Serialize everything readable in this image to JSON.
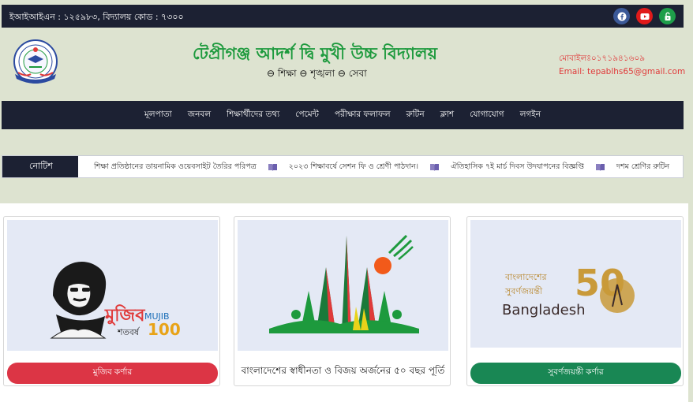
{
  "topbar": {
    "info": "ইআইআইএন : ১২৫৯৮৩, বিদ্যালয় কোড : ৭৩০০",
    "socials": [
      {
        "name": "facebook-icon",
        "color": "#3b5998"
      },
      {
        "name": "youtube-icon",
        "color": "#e01a1a"
      },
      {
        "name": "unlock-icon",
        "color": "#1e9e4a"
      }
    ]
  },
  "header": {
    "school_name": "টেপ্রীগঞ্জ আদর্শ দ্বি মুখী উচ্চ বিদ্যালয়",
    "motto": "⊖ শিক্ষা ⊖ শৃঙ্খলা ⊖ সেবা",
    "mobile": "মোবাইলঃ০১৭১৯৪১৬০৯",
    "email": "Email: tepablhs65@gmail.com"
  },
  "nav": {
    "items": [
      "মূলপাতা",
      "জনবল",
      "শিক্ষার্থীদের তথ্য",
      "পেমেন্ট",
      "পরীক্ষার ফলাফল",
      "রুটিন",
      "ক্লাশ",
      "যোগাযোগ",
      "লগইন"
    ]
  },
  "notice": {
    "label": "নোটিশ",
    "items": [
      "শিক্ষা প্রতিষ্ঠানের ডায়নামিক ওয়েবসাইট তৈরির পরিপত্র",
      "২০২৩ শিক্ষাবর্ষে সেশন ফি ও শ্রেণী পাঠদান।",
      "ঐতিহাসিক ৭ই মার্চ দিবস উদযাপনের বিজ্ঞপ্তি",
      "দশম শ্রেণির রুটিন"
    ]
  },
  "cards": [
    {
      "button": "মুজিব কর্ণার",
      "img_text_main": "মুজিব",
      "img_text_sub": "শতবর্ষ",
      "img_text_en": "MUJIB",
      "img_text_num": "100"
    },
    {
      "caption": "বাংলাদেশের স্বাধীনতা ও বিজয় অর্জনের ৫০ বছর পূর্তি"
    },
    {
      "button": "সুবর্ণজয়ন্তী কর্ণার",
      "img_text_bn1": "বাংলাদেশের",
      "img_text_bn2": "সুবর্ণজয়ন্তী",
      "img_text_en": "Bangladesh",
      "img_text_num": "50"
    }
  ],
  "colors": {
    "dark": "#1c2133",
    "green": "#1d9a3d",
    "red_accent": "#e03a3a",
    "btn_red": "#dc3545",
    "btn_green": "#198754"
  }
}
